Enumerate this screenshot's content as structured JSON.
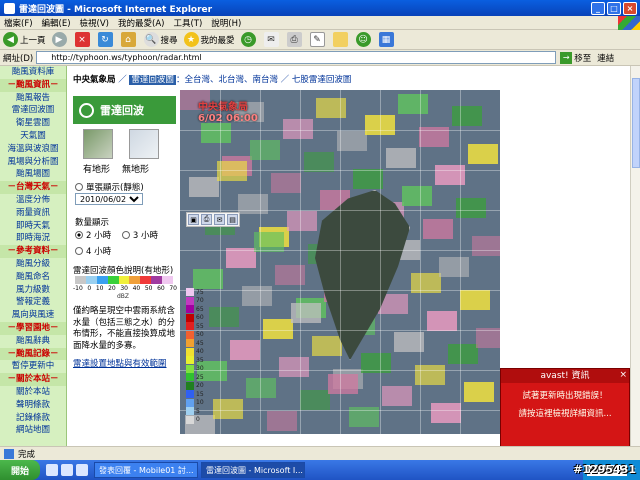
{
  "window": {
    "title": "雷達回波圖 - Microsoft Internet Explorer"
  },
  "menu": [
    "檔案(F)",
    "編輯(E)",
    "檢視(V)",
    "我的最愛(A)",
    "工具(T)",
    "說明(H)"
  ],
  "toolbar": {
    "back": "上一頁",
    "search": "搜尋",
    "favorites": "我的最愛"
  },
  "address": {
    "label": "網址(D)",
    "url": "http://typhoon.ws/typhoon/radar.html",
    "go": "移至",
    "links": "連結"
  },
  "leftnav": [
    {
      "label": "颱風資料庫",
      "head": false
    },
    {
      "label": "－颱風資訊－",
      "head": true
    },
    {
      "label": "颱風報告",
      "head": false
    },
    {
      "label": "雷達回波圖",
      "head": false
    },
    {
      "label": "衛星雲圖",
      "head": false
    },
    {
      "label": "天氣圖",
      "head": false
    },
    {
      "label": "海溫與波浪圖",
      "head": false
    },
    {
      "label": "風場與分析圖",
      "head": false
    },
    {
      "label": "颱風場圖",
      "head": false
    },
    {
      "label": "－台灣天氣－",
      "head": true
    },
    {
      "label": "溫度分佈",
      "head": false
    },
    {
      "label": "雨量資訊",
      "head": false
    },
    {
      "label": "即時天氣",
      "head": false
    },
    {
      "label": "即時海況",
      "head": false
    },
    {
      "label": "－參考資料－",
      "head": true
    },
    {
      "label": "颱風分級",
      "head": false
    },
    {
      "label": "颱風命名",
      "head": false
    },
    {
      "label": "風力級數",
      "head": false
    },
    {
      "label": "警報定義",
      "head": false
    },
    {
      "label": "風向與風速",
      "head": false
    },
    {
      "label": "－學習園地－",
      "head": true
    },
    {
      "label": "颱風辭典",
      "head": false
    },
    {
      "label": "－颱風記錄－",
      "head": true
    },
    {
      "label": "暫停更新中",
      "head": false
    },
    {
      "label": "－關於本站－",
      "head": true
    },
    {
      "label": "關於本站",
      "head": false
    },
    {
      "label": "聲明條款",
      "head": false
    },
    {
      "label": "記錄條款",
      "head": false
    },
    {
      "label": "網站地圖",
      "head": false
    }
  ],
  "breadcrumb": {
    "agency": "中央氣象局",
    "current": "雷達回波圖",
    "links": "全台灣、北台灣、南台灣 ／ 七股雷達回波圖"
  },
  "panel": {
    "banner": "雷達回波",
    "thumb_topo": "有地形",
    "thumb_flat": "無地形",
    "single_mode": "單張顯示(靜態)",
    "date": "2010/06/02 06:30",
    "count_label": "數量顯示",
    "count_opts": [
      "2 小時",
      "3 小時",
      "4 小時"
    ],
    "legend_title": "雷達回波顏色說明(有地形)",
    "legend_ticks": [
      "-10",
      "0",
      "10",
      "20",
      "30",
      "40",
      "50",
      "60",
      "70"
    ],
    "legend_unit": "dBZ",
    "description": "僅約略呈現空中雲雨系統含水量（包括三態之水）的分布情形，不能直接換算成地面降水量的多寡。",
    "note_link": "雷達設置地點與有效範圍"
  },
  "radar": {
    "title": "中央氣象局",
    "timestamp": "6/02 06:00",
    "dbz_labels": [
      "75",
      "70",
      "65",
      "60",
      "55",
      "50",
      "45",
      "40",
      "35",
      "30",
      "25",
      "20",
      "15",
      "10",
      "5",
      "0"
    ]
  },
  "avast": {
    "title": "avast! 資訊",
    "line1": "試著更新時出現錯誤！",
    "line2": "請按這裡檢視詳細資訊..."
  },
  "status": {
    "text": "完成"
  },
  "taskbar": {
    "start": "開始",
    "tasks": [
      "發表回覆 - Mobile01 討...",
      "雷達回波圖 - Microsoft I..."
    ],
    "search_placeholder": "Yahoo!搜尋"
  },
  "watermark": "#1295431",
  "colors": {
    "accent": "#3a9a3a",
    "nav_bg": "#d6f0c0",
    "radar_bg": "#5f7286",
    "alert": "#d41515"
  }
}
